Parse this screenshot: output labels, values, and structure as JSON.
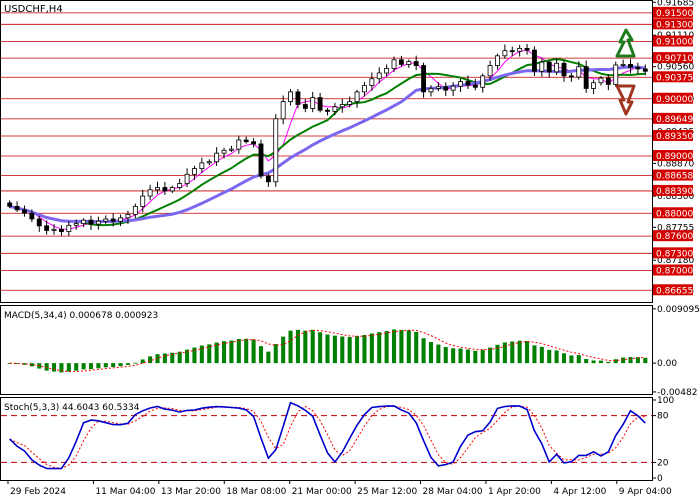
{
  "chart_data": [
    {
      "type": "candlestick",
      "title": "USDCHF,H4",
      "ylim": [
        0.8645,
        0.9169
      ],
      "price_ticks": [
        "0.91685",
        "0.91110",
        "0.90560",
        "0.90000",
        "0.89425",
        "0.88870",
        "0.88300",
        "0.87755",
        "0.87180",
        "0.86655"
      ],
      "horizontal_levels": [
        {
          "value": 0.915,
          "label": "0.91500"
        },
        {
          "value": 0.913,
          "label": "0.91300"
        },
        {
          "value": 0.91,
          "label": "0.91000"
        },
        {
          "value": 0.9071,
          "label": "0.90710"
        },
        {
          "value": 0.90375,
          "label": "0.90375"
        },
        {
          "value": 0.9,
          "label": "0.90000"
        },
        {
          "value": 0.89649,
          "label": "0.89649"
        },
        {
          "value": 0.8935,
          "label": "0.89350"
        },
        {
          "value": 0.89,
          "label": "0.89000"
        },
        {
          "value": 0.88658,
          "label": "0.88658"
        },
        {
          "value": 0.8839,
          "label": "0.88390"
        },
        {
          "value": 0.88,
          "label": "0.88000"
        },
        {
          "value": 0.876,
          "label": "0.87600"
        },
        {
          "value": 0.873,
          "label": "0.87300"
        },
        {
          "value": 0.87,
          "label": "0.87000"
        },
        {
          "value": 0.86655,
          "label": "0.86655"
        }
      ],
      "close_series": [
        0.8812,
        0.8806,
        0.88,
        0.879,
        0.8778,
        0.877,
        0.8772,
        0.8768,
        0.8779,
        0.8782,
        0.8788,
        0.8781,
        0.8786,
        0.879,
        0.8786,
        0.8792,
        0.8798,
        0.8812,
        0.883,
        0.8841,
        0.8845,
        0.8839,
        0.8845,
        0.8852,
        0.8868,
        0.8878,
        0.8888,
        0.889,
        0.8905,
        0.891,
        0.8912,
        0.8928,
        0.8925,
        0.8921,
        0.8865,
        0.8855,
        0.8965,
        0.8995,
        0.9012,
        0.899,
        0.8983,
        0.9002,
        0.898,
        0.8978,
        0.8986,
        0.899,
        0.8995,
        0.9012,
        0.9023,
        0.9035,
        0.9045,
        0.9053,
        0.9068,
        0.906,
        0.9065,
        0.9058,
        0.9012,
        0.9018,
        0.9021,
        0.9015,
        0.9022,
        0.903,
        0.9024,
        0.902,
        0.904,
        0.9058,
        0.9075,
        0.9084,
        0.9083,
        0.9088,
        0.9085,
        0.9048,
        0.9064,
        0.9047,
        0.9062,
        0.904,
        0.9038,
        0.9056,
        0.9018,
        0.9028,
        0.9036,
        0.9025,
        0.9059,
        0.906,
        0.9055,
        0.9052,
        0.9048
      ],
      "series": [
        {
          "color": "#ff00ff"
        },
        {
          "color": "#007f00"
        },
        {
          "color": "#7b68ee"
        }
      ],
      "x_labels": [
        "29 Feb 2024",
        "11 Mar 04:00",
        "13 Mar 20:00",
        "18 Mar 08:00",
        "21 Mar 00:00",
        "25 Mar 12:00",
        "28 Mar 04:00",
        "1 Apr 20:00",
        "4 Apr 12:00",
        "9 Apr 04:00"
      ],
      "arrows": [
        {
          "direction": "up",
          "color": "#1e7b1e"
        },
        {
          "direction": "down",
          "color": "#a0341e"
        }
      ]
    },
    {
      "type": "bar",
      "title": "MACD(5,34,4) 0.000678 0.000923",
      "ylim": [
        -0.005,
        0.0094
      ],
      "ticks": [
        "0.009095",
        "0.00",
        "-0.00482"
      ],
      "color": "#008000",
      "signal_color": "#ff0000"
    },
    {
      "type": "line",
      "title": "Stoch(5,3,3) 44.6043 60.5334",
      "ylim": [
        0,
        100
      ],
      "ticks": [
        "100",
        "80",
        "20",
        "0"
      ],
      "levels": [
        80,
        20
      ],
      "main_color": "#0000cd",
      "signal_color": "#ff0000"
    }
  ]
}
